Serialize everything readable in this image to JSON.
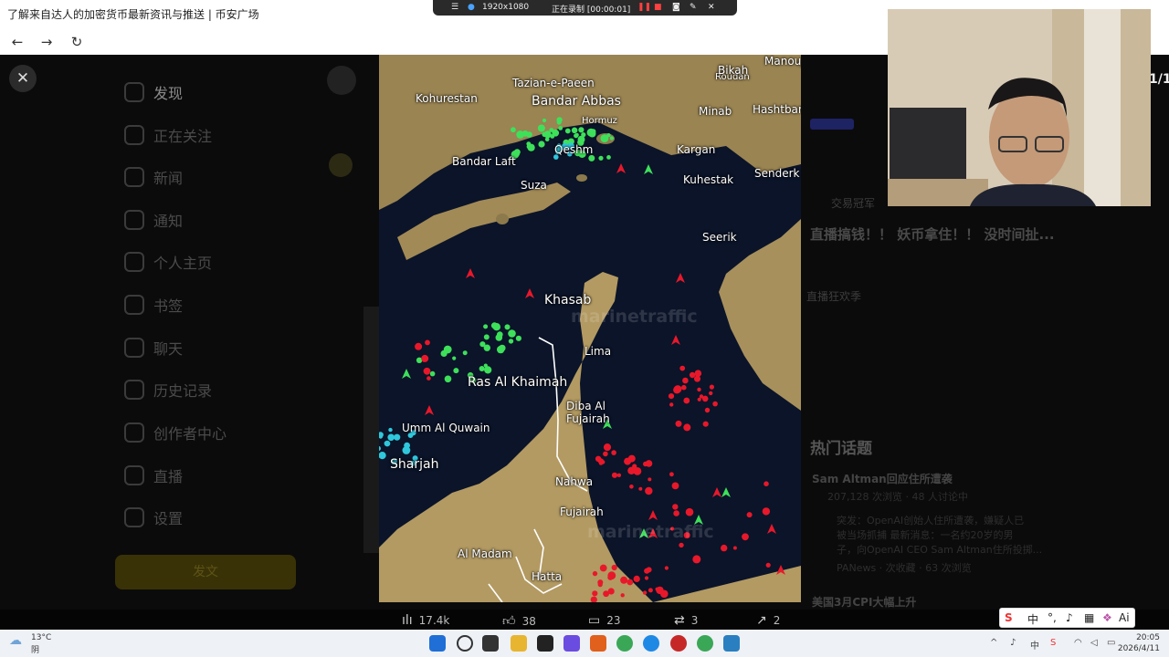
{
  "browser": {
    "tab_title": "了解来自达人的加密货币最新资讯与推送 | 币安广场",
    "back_glyph": "←",
    "forward_glyph": "→",
    "reload_glyph": "↻"
  },
  "recorder": {
    "resolution": "1920x1080",
    "status": "正在录制 [00:00:01]"
  },
  "sidebar": {
    "items": [
      {
        "label": "发现",
        "icon": "discover-icon"
      },
      {
        "label": "正在关注",
        "icon": "following-icon"
      },
      {
        "label": "新闻",
        "icon": "news-icon"
      },
      {
        "label": "通知",
        "icon": "bell-icon"
      },
      {
        "label": "个人主页",
        "icon": "profile-icon"
      },
      {
        "label": "书签",
        "icon": "bookmark-icon"
      },
      {
        "label": "聊天",
        "icon": "mail-icon"
      },
      {
        "label": "历史记录",
        "icon": "history-icon"
      },
      {
        "label": "创作者中心",
        "icon": "creator-icon"
      },
      {
        "label": "直播",
        "icon": "live-icon"
      },
      {
        "label": "设置",
        "icon": "settings-icon"
      }
    ],
    "post_button": "发文"
  },
  "right_panel": {
    "live_label": "交易冠军",
    "live_title": "直播搞钱！！ 妖币拿住！！ 没时间扯...",
    "live_tag": "直播狂欢季",
    "hot_topics_heading": "热门话题",
    "topics": [
      {
        "title": "Sam Altman回应住所遭袭",
        "meta": "207,128 次浏览 · 48 人讨论中",
        "snippet_1": "突发：OpenAI创始人住所遭袭，嫌疑人已",
        "snippet_2": "被当场抓捕 最新消息：一名约20岁的男",
        "snippet_3": "子，向OpenAI CEO Sam Altman住所投掷...",
        "footer": "PANews · 次收藏 · 63 次浏览"
      },
      {
        "title": "美国3月CPI大幅上升"
      }
    ]
  },
  "viewer": {
    "counter": "1/1",
    "close_glyph": "✕"
  },
  "map": {
    "watermarks": [
      "marinetraffic",
      "marinetraffic"
    ],
    "labels": [
      {
        "text": "Roudan",
        "size": "s"
      },
      {
        "text": "Bikah",
        "size": "m"
      },
      {
        "text": "Manouj",
        "size": "m"
      },
      {
        "text": "Tazian-e-Paeen",
        "size": "m"
      },
      {
        "text": "Kohurestan",
        "size": "m"
      },
      {
        "text": "Bandar Abbas",
        "size": "l"
      },
      {
        "text": "Hormuz",
        "size": "m"
      },
      {
        "text": "Minab",
        "size": "m"
      },
      {
        "text": "Hashtbandi",
        "size": "m"
      },
      {
        "text": "Qeshm",
        "size": "m"
      },
      {
        "text": "Kargan",
        "size": "m"
      },
      {
        "text": "Bandar Laft",
        "size": "m"
      },
      {
        "text": "Kuhestak",
        "size": "m"
      },
      {
        "text": "Senderk",
        "size": "m"
      },
      {
        "text": "Suza",
        "size": "m"
      },
      {
        "text": "Seerik",
        "size": "m"
      },
      {
        "text": "Khasab",
        "size": "l"
      },
      {
        "text": "Lima",
        "size": "m"
      },
      {
        "text": "Ras Al Khaimah",
        "size": "l"
      },
      {
        "text": "Diba Al",
        "size": "m"
      },
      {
        "text": "Fujairah",
        "size": "m"
      },
      {
        "text": "Umm Al Quwain",
        "size": "m"
      },
      {
        "text": "Sharjah",
        "size": "l"
      },
      {
        "text": "Nahwa",
        "size": "m"
      },
      {
        "text": "Fujairah",
        "size": "m"
      },
      {
        "text": "Al Madam",
        "size": "m"
      },
      {
        "text": "Hatta",
        "size": "m"
      }
    ]
  },
  "actions": {
    "views": "17.4k",
    "likes": "38",
    "comments": "23",
    "reposts": "3",
    "shares": "2"
  },
  "taskbar": {
    "temperature": "13°C",
    "weather": "阴",
    "time": "20:05",
    "date": "2026/4/11"
  },
  "ime": {
    "mode": "中"
  },
  "colors": {
    "ship_red": "#e8182a",
    "ship_green": "#3ee05a",
    "ship_cyan": "#2fc7dc",
    "water": "#0b1429",
    "land": "#a7905c"
  }
}
